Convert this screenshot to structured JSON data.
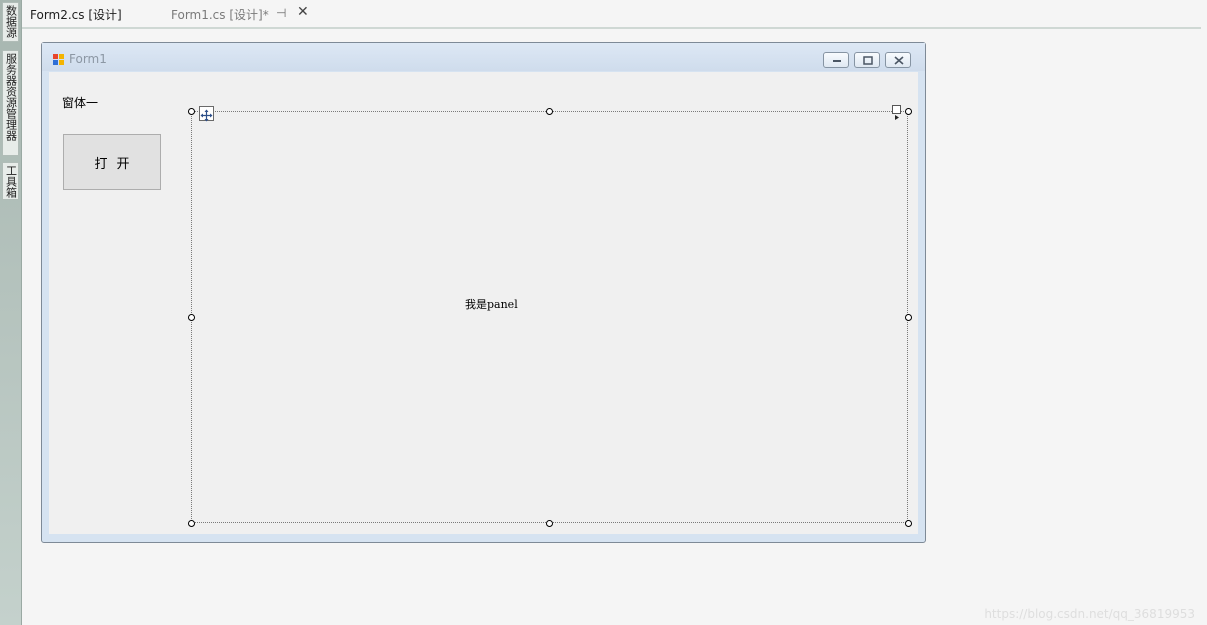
{
  "side_panel": {
    "tabs": [
      "数据源",
      "服务器资源管理器",
      "工具箱"
    ]
  },
  "document_tabs": {
    "active_label": "Form2.cs [设计]",
    "inactive_label": "Form1.cs [设计]*",
    "pin_glyph": "⊣",
    "close_glyph": "✕"
  },
  "form": {
    "title": "Form1",
    "label_text": "窗体一",
    "button_label": "打开",
    "panel_text": "我是panel"
  },
  "watermark": "https://blog.csdn.net/qq_36819953",
  "colors": {
    "form_chrome": "#d6e3f1",
    "client_bg": "#f0f0f0",
    "icon_red": "#e8452b",
    "icon_yellow": "#f4b400",
    "icon_blue": "#2f6fd6"
  }
}
